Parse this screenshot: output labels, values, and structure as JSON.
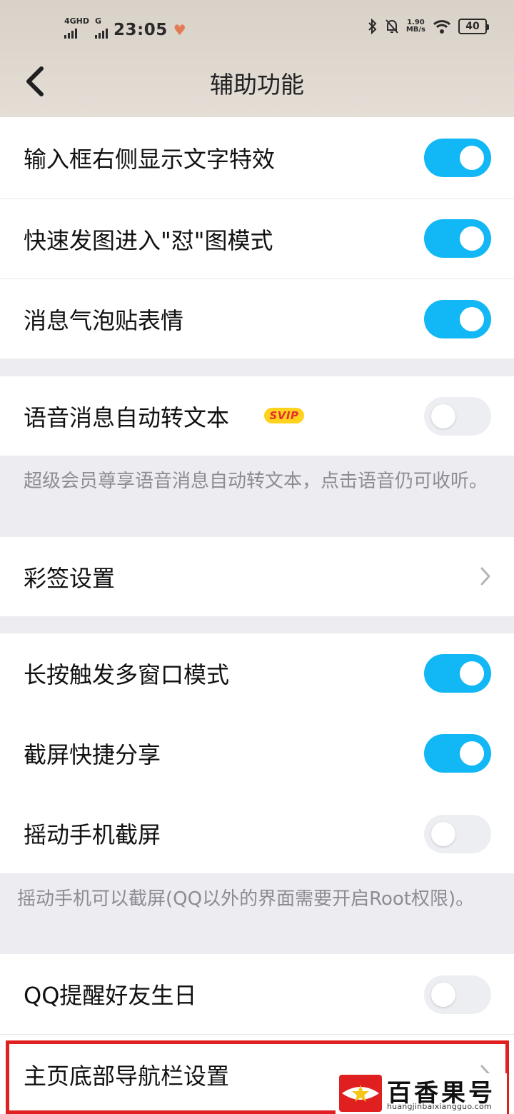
{
  "status_bar": {
    "network_left": "4GHD",
    "network_right": "G",
    "time": "23:05",
    "speed_value": "1.90",
    "speed_unit": "MB/s",
    "battery": "40"
  },
  "header": {
    "title": "辅助功能",
    "back_icon": "chevron-left-icon"
  },
  "settings": [
    {
      "label": "输入框右侧显示文字特效",
      "toggle": "on"
    },
    {
      "label": "快速发图进入\"怼\"图模式",
      "toggle": "on"
    },
    {
      "label": "消息气泡贴表情",
      "toggle": "on"
    },
    {
      "label": "语音消息自动转文本",
      "badge": "SVIP",
      "toggle": "off"
    },
    {
      "label": "彩签设置"
    },
    {
      "label": "长按触发多窗口模式",
      "toggle": "on"
    },
    {
      "label": "截屏快捷分享",
      "toggle": "on"
    },
    {
      "label": "摇动手机截屏",
      "toggle": "off"
    },
    {
      "label": "QQ提醒好友生日",
      "toggle": "off"
    },
    {
      "label": "主页底部导航栏设置"
    }
  ],
  "notes": {
    "voice_to_text": "超级会员尊享语音消息自动转文本，点击语音仍可收听。",
    "shake_screenshot": "摇动手机可以截屏(QQ以外的界面需要开启Root权限)。"
  },
  "watermark": {
    "title": "百香果号",
    "url": "huangjinbaixiangguo.com"
  },
  "colors": {
    "toggle_on": "#12b7f5",
    "toggle_off": "#eceef2",
    "highlight": "#e02020",
    "badge_bg": "#ffd21e",
    "badge_text": "#e6312c"
  }
}
